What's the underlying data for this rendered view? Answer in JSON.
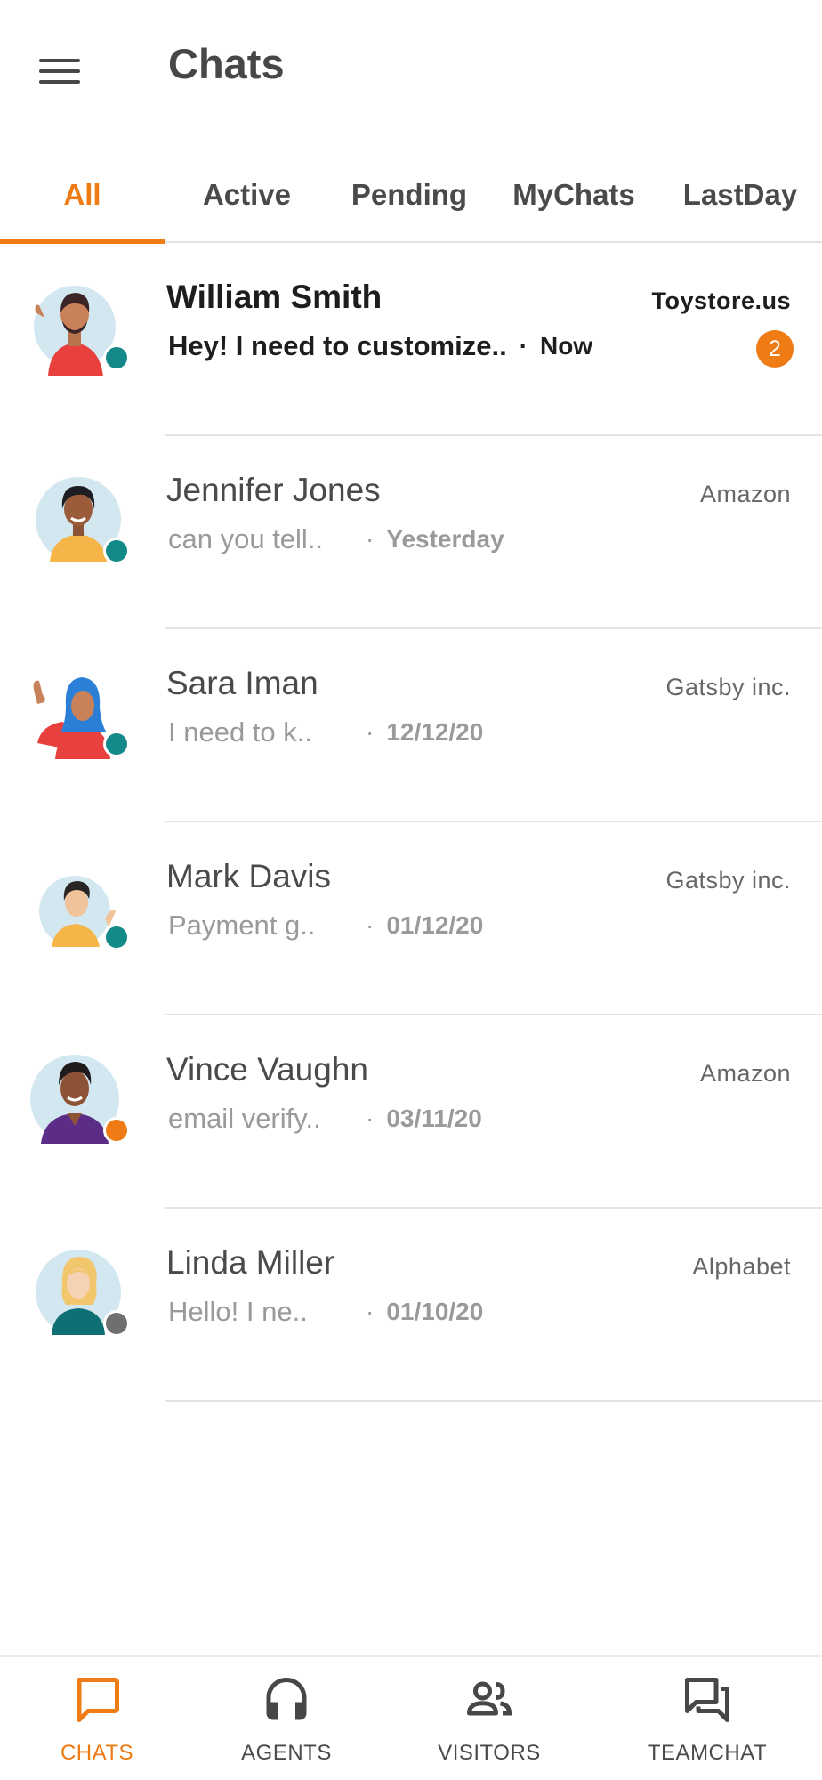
{
  "header": {
    "title": "Chats"
  },
  "tabs": [
    {
      "label": "All",
      "active": true
    },
    {
      "label": "Active",
      "active": false
    },
    {
      "label": "Pending",
      "active": false
    },
    {
      "label": "MyChats",
      "active": false
    },
    {
      "label": "LastDay",
      "active": false
    }
  ],
  "chats": [
    {
      "name": "William Smith",
      "company": "Toystore.us",
      "preview": "Hey! I need to customize..",
      "time": "Now",
      "unread": "2",
      "status": "online"
    },
    {
      "name": "Jennifer Jones",
      "company": "Amazon",
      "preview": "can you tell..",
      "time": "Yesterday",
      "status": "online"
    },
    {
      "name": "Sara Iman",
      "company": "Gatsby inc.",
      "preview": "I need to k..",
      "time": "12/12/20",
      "status": "online"
    },
    {
      "name": "Mark Davis",
      "company": "Gatsby inc.",
      "preview": "Payment g..",
      "time": "01/12/20",
      "status": "online"
    },
    {
      "name": "Vince Vaughn",
      "company": "Amazon",
      "preview": "email verify..",
      "time": "03/11/20",
      "status": "away"
    },
    {
      "name": "Linda Miller",
      "company": "Alphabet",
      "preview": "Hello! I ne..",
      "time": "01/10/20",
      "status": "offline"
    }
  ],
  "separator": "·",
  "bottom_nav": [
    {
      "label": "CHATS",
      "icon": "chat-bubble-icon",
      "active": true
    },
    {
      "label": "AGENTS",
      "icon": "headset-icon",
      "active": false
    },
    {
      "label": "VISITORS",
      "icon": "people-icon",
      "active": false
    },
    {
      "label": "TEAMCHAT",
      "icon": "forum-icon",
      "active": false
    }
  ],
  "colors": {
    "accent": "#ee7b13",
    "online": "#14898a",
    "away": "#ee7b13",
    "offline": "#6f6f6f"
  }
}
